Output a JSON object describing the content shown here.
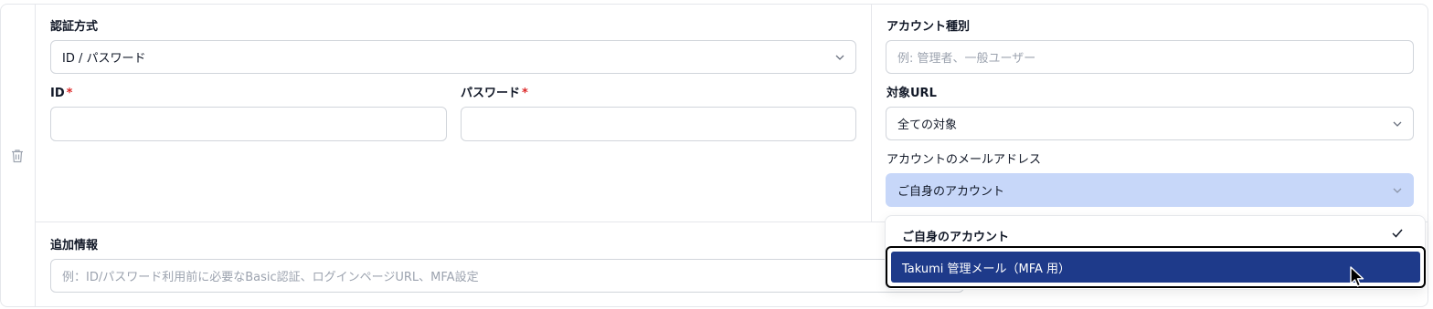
{
  "left": {
    "auth_method_label": "認証方式",
    "auth_method_value": "ID / パスワード",
    "id_label": "ID",
    "password_label": "パスワード",
    "required_mark": "*",
    "id_value": "",
    "password_value": ""
  },
  "right": {
    "account_type_label": "アカウント種別",
    "account_type_placeholder": "例: 管理者、一般ユーザー",
    "target_url_label": "対象URL",
    "target_url_value": "全ての対象",
    "account_email_label": "アカウントのメールアドレス",
    "account_email_value": "ご自身のアカウント"
  },
  "additional": {
    "label": "追加情報",
    "placeholder": "例：ID/パスワード利用前に必要なBasic認証、ログインページURL、MFA設定"
  },
  "dropdown": {
    "options": [
      {
        "label": "ご自身のアカウント",
        "selected": true
      },
      {
        "label": "Takumi 管理メール（MFA 用）",
        "highlighted": true
      }
    ]
  },
  "colors": {
    "focused_select_bg": "#c7d7f9",
    "highlight_bg": "#1e3a8a",
    "required": "#dc2626"
  }
}
